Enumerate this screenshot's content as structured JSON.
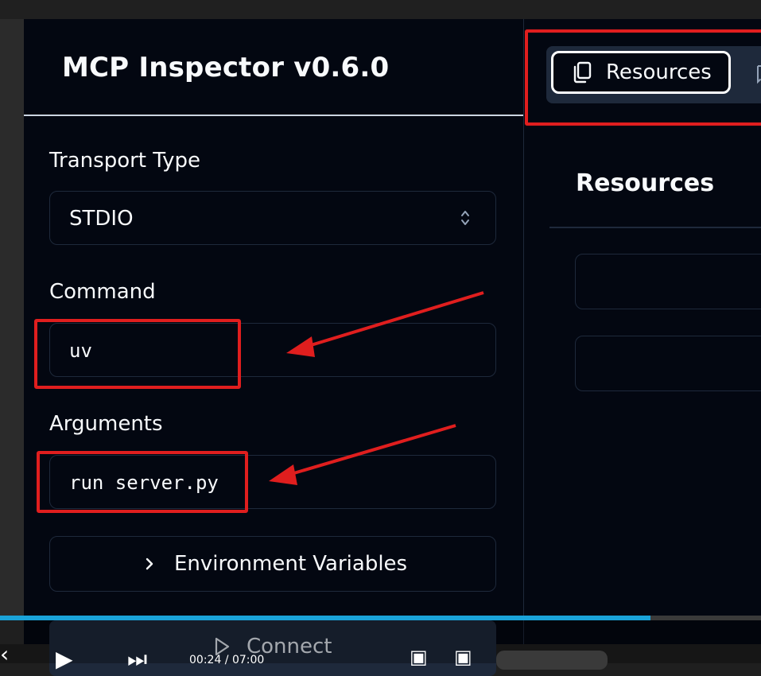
{
  "app": {
    "title": "MCP Inspector v0.6.0"
  },
  "sidebar": {
    "transport_label": "Transport Type",
    "transport_value": "STDIO",
    "command_label": "Command",
    "command_value": "uv",
    "arguments_label": "Arguments",
    "arguments_value": "run server.py",
    "env_button_label": "Environment Variables",
    "connect_label": "Connect"
  },
  "tabs": {
    "active": "Resources"
  },
  "main": {
    "section_title": "Resources"
  },
  "player": {
    "time": "00:24 / 07:00",
    "progress": 0.855
  },
  "colors": {
    "background": "#030711",
    "border": "#1e293b",
    "highlight": "#e01e1e",
    "progress": "#1aa3d9"
  }
}
